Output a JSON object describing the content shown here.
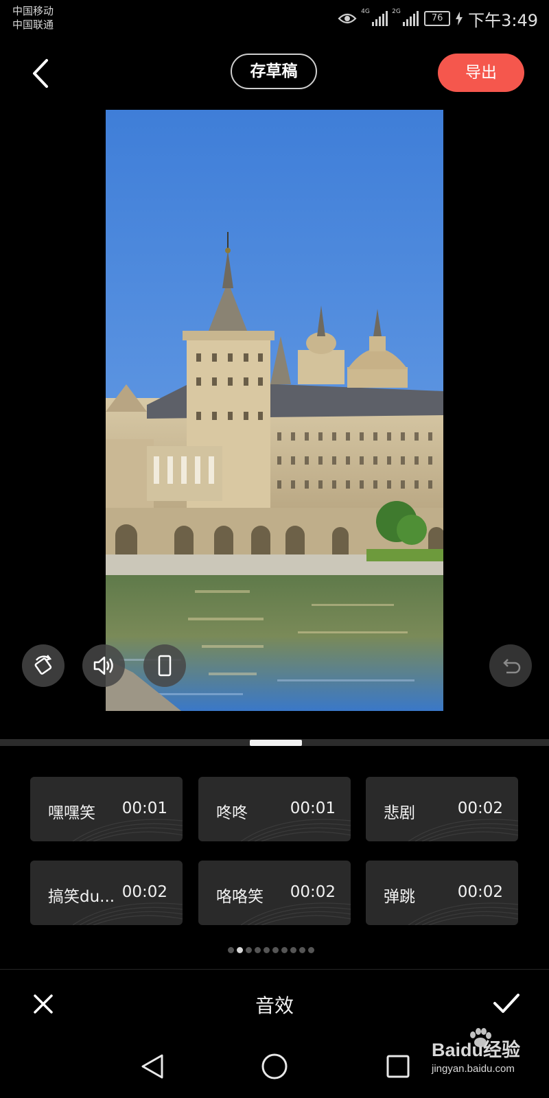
{
  "status_bar": {
    "carrier1": "中国移动",
    "carrier2": "中国联通",
    "net1": "4G",
    "net2": "2G",
    "battery": "76",
    "time": "下午3:49"
  },
  "top_bar": {
    "draft_label": "存草稿",
    "export_label": "导出"
  },
  "sound_effects": [
    {
      "name": "嘿嘿笑",
      "duration": "00:01"
    },
    {
      "name": "咚咚",
      "duration": "00:01"
    },
    {
      "name": "悲剧",
      "duration": "00:02"
    },
    {
      "name": "搞笑du...",
      "duration": "00:02"
    },
    {
      "name": "咯咯笑",
      "duration": "00:02"
    },
    {
      "name": "弹跳",
      "duration": "00:02"
    }
  ],
  "pager": {
    "total": 10,
    "active_index": 1
  },
  "panel": {
    "title": "音效"
  },
  "watermark": {
    "brand": "Baidu经验",
    "url": "jingyan.baidu.com"
  },
  "colors": {
    "accent": "#f5574d",
    "card_bg": "#2a2a2a",
    "background": "#000000"
  }
}
